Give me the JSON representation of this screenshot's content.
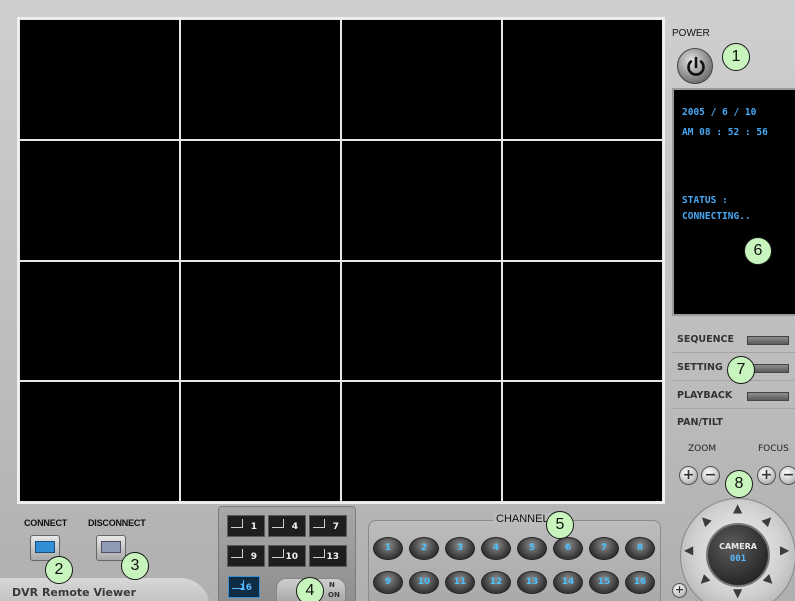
{
  "app": {
    "title": "DVR Remote Viewer"
  },
  "power": {
    "label": "POWER",
    "icon": "power-icon"
  },
  "info_panel": {
    "date": "2005 / 6 / 10",
    "time": "AM 08 : 52 : 56",
    "status_label": "STATUS :",
    "status_value": "CONNECTING.."
  },
  "menu": {
    "sequence": "SEQUENCE",
    "setting": "SETTING",
    "playback": "PLAYBACK",
    "pan_tilt": "PAN/TILT"
  },
  "ptz": {
    "zoom_label": "ZOOM",
    "focus_label": "FOCUS",
    "camera_label": "CAMERA",
    "camera_number": "001"
  },
  "connect": {
    "connect_label": "CONNECT",
    "disconnect_label": "DISCONNECT"
  },
  "division": {
    "buttons": [
      "1",
      "4",
      "7",
      "9",
      "10",
      "13",
      "16"
    ],
    "active": "16",
    "partial_label_1": "N",
    "partial_label_2": "ON"
  },
  "channels": {
    "label": "CHANNEL",
    "buttons": [
      "1",
      "2",
      "3",
      "4",
      "5",
      "6",
      "7",
      "8",
      "9",
      "10",
      "11",
      "12",
      "13",
      "14",
      "15",
      "16"
    ]
  },
  "markers": [
    "1",
    "2",
    "3",
    "4",
    "5",
    "6",
    "7",
    "8"
  ],
  "colors": {
    "info_text": "#48a9f5",
    "channel_text": "#4ac2ff",
    "marker_bg": "#c7f5bd"
  }
}
